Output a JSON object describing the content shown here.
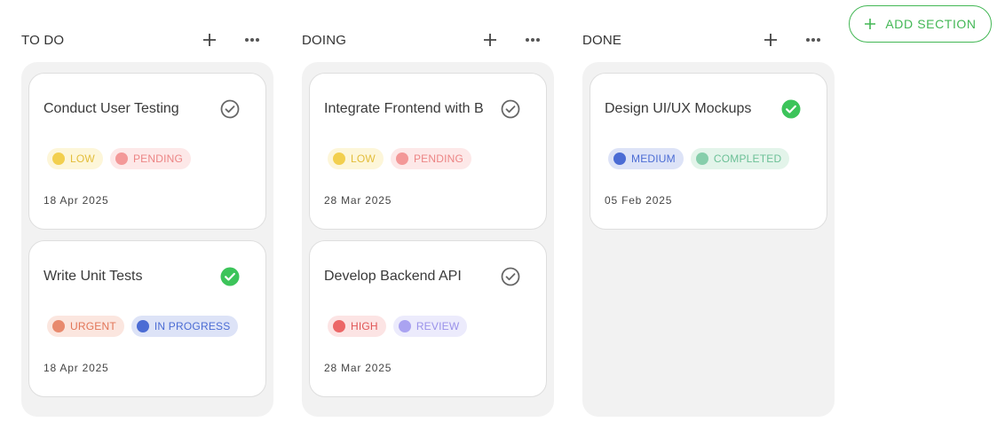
{
  "add_section_label": "ADD SECTION",
  "colors": {
    "accent_green": "#43b755",
    "low": {
      "bg": "#fdf6d9",
      "dot": "#f2cf4e",
      "text": "#e3bd3a"
    },
    "pending": {
      "bg": "#fde8e8",
      "dot": "#f39898",
      "text": "#ec8585"
    },
    "urgent": {
      "bg": "#fbe6df",
      "dot": "#e88a6e",
      "text": "#e27557"
    },
    "in_progress": {
      "bg": "#dde3f7",
      "dot": "#4b6cd4",
      "text": "#4b6cd4"
    },
    "high": {
      "bg": "#fce4e4",
      "dot": "#ec6767",
      "text": "#e05656"
    },
    "review": {
      "bg": "#ecebfc",
      "dot": "#aaa3f1",
      "text": "#9a92ea"
    },
    "medium": {
      "bg": "#dde3f7",
      "dot": "#4b6cd4",
      "text": "#4b6cd4"
    },
    "completed": {
      "bg": "#e3f4ea",
      "dot": "#86ceab",
      "text": "#6cc097"
    }
  },
  "columns": [
    {
      "title": "TO DO",
      "cards": [
        {
          "title": "Conduct User Testing",
          "done": false,
          "chips": [
            {
              "label": "LOW",
              "style": "low"
            },
            {
              "label": "PENDING",
              "style": "pending"
            }
          ],
          "date": "18 Apr 2025"
        },
        {
          "title": "Write Unit Tests",
          "done": true,
          "chips": [
            {
              "label": "URGENT",
              "style": "urgent"
            },
            {
              "label": "IN PROGRESS",
              "style": "in_progress"
            }
          ],
          "date": "18 Apr 2025"
        }
      ]
    },
    {
      "title": "DOING",
      "cards": [
        {
          "title": "Integrate Frontend with B",
          "done": false,
          "chips": [
            {
              "label": "LOW",
              "style": "low"
            },
            {
              "label": "PENDING",
              "style": "pending"
            }
          ],
          "date": "28 Mar 2025"
        },
        {
          "title": "Develop Backend API",
          "done": false,
          "chips": [
            {
              "label": "HIGH",
              "style": "high"
            },
            {
              "label": "REVIEW",
              "style": "review"
            }
          ],
          "date": "28 Mar 2025"
        }
      ]
    },
    {
      "title": "DONE",
      "cards": [
        {
          "title": "Design UI/UX Mockups",
          "done": true,
          "chips": [
            {
              "label": "MEDIUM",
              "style": "medium"
            },
            {
              "label": "COMPLETED",
              "style": "completed"
            }
          ],
          "date": "05 Feb 2025"
        }
      ]
    }
  ]
}
